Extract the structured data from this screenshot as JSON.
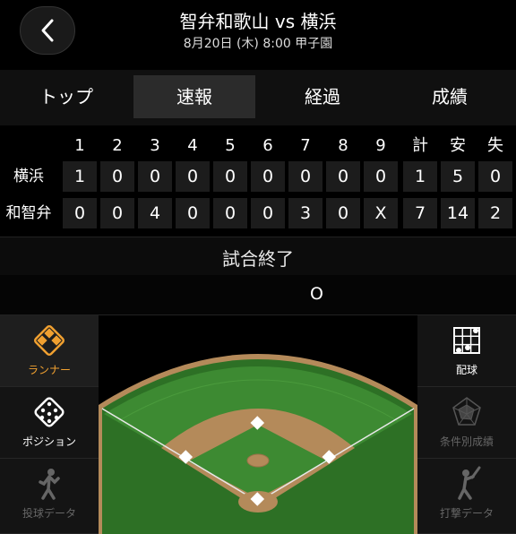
{
  "header": {
    "title": "智弁和歌山 vs 横浜",
    "subtitle": "8月20日 (木) 8:00 甲子園"
  },
  "tabs": [
    {
      "label": "トップ",
      "active": false
    },
    {
      "label": "速報",
      "active": true
    },
    {
      "label": "経過",
      "active": false
    },
    {
      "label": "成績",
      "active": false
    }
  ],
  "scoreboard": {
    "innings": [
      "1",
      "2",
      "3",
      "4",
      "5",
      "6",
      "7",
      "8",
      "9"
    ],
    "totals_headers": [
      "計",
      "安",
      "失"
    ],
    "teams": [
      {
        "name": "横浜",
        "innings": [
          "1",
          "0",
          "0",
          "0",
          "0",
          "0",
          "0",
          "0",
          "0"
        ],
        "totals": [
          "1",
          "5",
          "0"
        ]
      },
      {
        "name": "和智弁",
        "innings": [
          "0",
          "0",
          "4",
          "0",
          "0",
          "0",
          "3",
          "0",
          "X"
        ],
        "totals": [
          "7",
          "14",
          "2"
        ]
      }
    ]
  },
  "status": {
    "text": "試合終了",
    "outs": "O"
  },
  "left_menu": [
    {
      "label": "ランナー",
      "icon": "runner-diamond-icon",
      "active": true,
      "color": "#f0a030"
    },
    {
      "label": "ポジション",
      "icon": "position-diamond-icon",
      "active": false,
      "color": "#ffffff"
    },
    {
      "label": "投球データ",
      "icon": "pitcher-icon",
      "active": false,
      "color": "#666666"
    }
  ],
  "right_menu": [
    {
      "label": "配球",
      "icon": "pitch-grid-icon",
      "active": false,
      "color": "#ffffff"
    },
    {
      "label": "条件別成績",
      "icon": "radar-chart-icon",
      "active": false,
      "color": "#666666"
    },
    {
      "label": "打撃データ",
      "icon": "batter-icon",
      "active": false,
      "color": "#666666"
    }
  ],
  "colors": {
    "grass": "#3d8a32",
    "grass_dark": "#2a6b22",
    "dirt": "#b48a5a",
    "accent": "#f0a030"
  }
}
